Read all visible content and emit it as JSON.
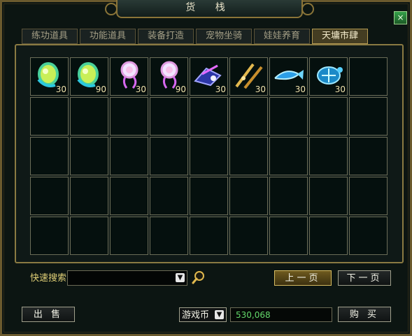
{
  "window": {
    "title": "货 栈",
    "close_label": "×"
  },
  "tabs": [
    {
      "label": "练功道具",
      "active": false
    },
    {
      "label": "功能道具",
      "active": false
    },
    {
      "label": "装备打造",
      "active": false
    },
    {
      "label": "宠物坐骑",
      "active": false
    },
    {
      "label": "娃娃养育",
      "active": false
    },
    {
      "label": "天墉市肆",
      "active": true
    }
  ],
  "items": [
    {
      "icon": "green-orb-icon",
      "quantity": "30"
    },
    {
      "icon": "green-orb-icon",
      "quantity": "90"
    },
    {
      "icon": "pink-pendant-icon",
      "quantity": "30"
    },
    {
      "icon": "pink-pendant-icon",
      "quantity": "90"
    },
    {
      "icon": "blue-crystal-icon",
      "quantity": "30"
    },
    {
      "icon": "golden-weapon-icon",
      "quantity": "30"
    },
    {
      "icon": "water-fish-icon",
      "quantity": "30"
    },
    {
      "icon": "blue-turtle-icon",
      "quantity": "30"
    }
  ],
  "search": {
    "label": "快速搜索",
    "value": "",
    "arrow": "▼"
  },
  "pagination": {
    "prev_label": "上一页",
    "next_label": "下一页"
  },
  "footer": {
    "sell_label": "出 售",
    "currency_label": "游戏币",
    "currency_arrow": "▼",
    "amount": "530,068",
    "buy_label": "购 买"
  },
  "colors": {
    "accent_gold": "#d8bd62",
    "money_green": "#63d86a"
  }
}
